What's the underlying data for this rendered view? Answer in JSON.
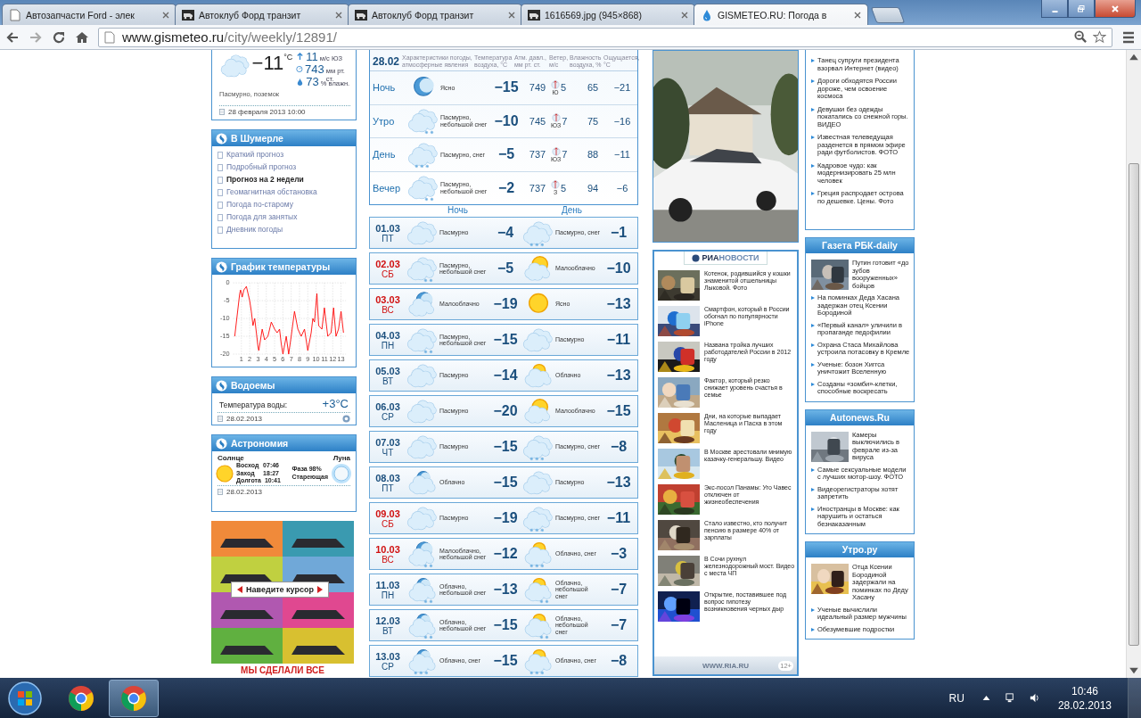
{
  "browser": {
    "tabs": [
      {
        "title": "Автозапчасти Ford - элек",
        "selected": false,
        "kind": "page"
      },
      {
        "title": "Автоклуб Форд транзит",
        "selected": false,
        "kind": "van"
      },
      {
        "title": "Автоклуб Форд транзит",
        "selected": false,
        "kind": "van"
      },
      {
        "title": "1616569.jpg (945×868)",
        "selected": false,
        "kind": "van"
      },
      {
        "title": "GISMETEO.RU: Погода в",
        "selected": true,
        "kind": "drop"
      }
    ],
    "address": {
      "host": "www.gismeteo.ru",
      "path": "/city/weekly/12891/"
    }
  },
  "current": {
    "temp": "−11",
    "unit": "°C",
    "wind_speed": "11",
    "wind_unit": "м/с ЮЗ",
    "pressure": "743",
    "pressure_unit": "мм рт. ст.",
    "humidity": "73",
    "humidity_unit": "% влажн.",
    "description": "Пасмурно, поземок",
    "timestamp": "28 февраля 2013 10:00"
  },
  "city_menu": {
    "title": "В Шумерле",
    "items": [
      {
        "label": "Краткий прогноз",
        "selected": false
      },
      {
        "label": "Подробный прогноз",
        "selected": false
      },
      {
        "label": "Прогноз на 2 недели",
        "selected": true
      },
      {
        "label": "Геомагнитная обстановка",
        "selected": false
      },
      {
        "label": "Погода по-старому",
        "selected": false
      },
      {
        "label": "Погода для занятых",
        "selected": false
      },
      {
        "label": "Дневник погоды",
        "selected": false
      }
    ]
  },
  "temperature_chart": {
    "title": "График температуры",
    "chart_data": {
      "type": "line",
      "grid": true,
      "x": [
        0.2,
        0.8,
        0.9,
        1.1,
        1.3,
        1.6,
        1.8,
        2.0,
        2.2,
        2.4,
        2.6,
        2.8,
        3.0,
        3.1,
        3.5,
        3.8,
        4.2,
        4.6,
        5.0,
        5.3,
        5.6,
        5.8,
        6.0,
        6.4,
        6.7,
        7.0,
        7.4,
        7.8,
        8.2,
        8.6,
        9.0,
        9.4,
        9.6,
        9.8,
        10.1,
        10.3,
        10.7,
        11.0,
        11.4,
        11.8,
        12.1,
        12.4,
        12.7,
        13.0,
        13.3
      ],
      "series": [
        {
          "color": "#ff0000",
          "values": [
            -15,
            -3,
            -2,
            -4,
            -2,
            -1,
            -3,
            -5,
            -8,
            -12,
            -10,
            -14,
            -18,
            -19,
            -13,
            -16,
            -15,
            -11,
            -13,
            -14,
            -13,
            -17,
            -20,
            -15,
            -20,
            -15,
            -8,
            -13,
            -15,
            -13,
            -19,
            -14,
            -10,
            -11,
            -3,
            -12,
            -13,
            -7,
            -15,
            -14,
            -7,
            -15,
            -13,
            -8,
            -14
          ]
        }
      ],
      "xlim": [
        0,
        13.6
      ],
      "ylim": [
        -20,
        0
      ],
      "xticks": [
        1,
        2,
        3,
        4,
        5,
        6,
        7,
        8,
        9,
        10,
        11,
        12,
        13
      ],
      "yticks": [
        0,
        -5,
        -10,
        -15,
        -20
      ]
    }
  },
  "water": {
    "title": "Водоемы",
    "label": "Температура воды:",
    "value": "+3°C",
    "date": "28.02.2013"
  },
  "astronomy": {
    "title": "Астрономия",
    "sun_label": "Солнце",
    "moon_label": "Луна",
    "sun_rows": [
      {
        "label": "Восход",
        "value": "07:46"
      },
      {
        "label": "Заход",
        "value": "18:27"
      },
      {
        "label": "Долгота",
        "value": "10:41"
      }
    ],
    "phase": "Фаза 98%",
    "phase_name": "Стареющая",
    "date": "28.02.2013"
  },
  "ad_banner": {
    "button": "Наведите курсор",
    "caption": "МЫ СДЕЛАЛИ ВСЕ"
  },
  "today": {
    "date": "28.02",
    "columns": [
      "Характеристики погоды, атмосферные явления",
      "Температура воздуха, °C",
      "Атм. давл., мм рт. ст.",
      "Ветер, м/с",
      "Влажность воздуха, %",
      "Ощущается, °C"
    ],
    "rows": [
      {
        "period": "Ночь",
        "icon": {
          "kind": "clear_night"
        },
        "description": "Ясно",
        "temp": "−15",
        "pressure": "749",
        "wind_speed": "5",
        "wind_direction": "Ю",
        "humidity": "65",
        "feels": "−21"
      },
      {
        "period": "Утро",
        "icon": {
          "kind": "overcast_light_snow"
        },
        "description": "Пасмурно, небольшой снег",
        "temp": "−10",
        "pressure": "745",
        "wind_speed": "7",
        "wind_direction": "ЮЗ",
        "humidity": "75",
        "feels": "−16"
      },
      {
        "period": "День",
        "icon": {
          "kind": "overcast_snow"
        },
        "description": "Пасмурно, снег",
        "temp": "−5",
        "pressure": "737",
        "wind_speed": "7",
        "wind_direction": "ЮЗ",
        "humidity": "88",
        "feels": "−11"
      },
      {
        "period": "Вечер",
        "icon": {
          "kind": "overcast_light_snow"
        },
        "description": "Пасмурно, небольшой снег",
        "temp": "−2",
        "pressure": "737",
        "wind_speed": "5",
        "wind_direction": "З",
        "humidity": "94",
        "feels": "−6"
      }
    ]
  },
  "forecast": {
    "night_label": "Ночь",
    "day_label": "День",
    "days": [
      {
        "date": "01.03",
        "weekday": "ПТ",
        "weekend": false,
        "night": {
          "kind": "overcast",
          "description": "Пасмурно",
          "temp": "−4"
        },
        "day": {
          "kind": "overcast_snow",
          "description": "Пасмурно, снег",
          "temp": "−1"
        }
      },
      {
        "date": "02.03",
        "weekday": "СБ",
        "weekend": true,
        "night": {
          "kind": "overcast_light_snow",
          "description": "Пасмурно, небольшой снег",
          "temp": "−5"
        },
        "day": {
          "kind": "partly",
          "description": "Малооблачно",
          "temp": "−10"
        }
      },
      {
        "date": "03.03",
        "weekday": "ВС",
        "weekend": true,
        "night": {
          "kind": "partly",
          "description": "Малооблачно",
          "temp": "−19"
        },
        "day": {
          "kind": "clear",
          "description": "Ясно",
          "temp": "−13"
        }
      },
      {
        "date": "04.03",
        "weekday": "ПН",
        "weekend": false,
        "night": {
          "kind": "overcast_light_snow",
          "description": "Пасмурно, небольшой снег",
          "temp": "−15"
        },
        "day": {
          "kind": "overcast",
          "description": "Пасмурно",
          "temp": "−11"
        }
      },
      {
        "date": "05.03",
        "weekday": "ВТ",
        "weekend": false,
        "night": {
          "kind": "overcast",
          "description": "Пасмурно",
          "temp": "−14"
        },
        "day": {
          "kind": "cloudy",
          "description": "Облачно",
          "temp": "−13"
        }
      },
      {
        "date": "06.03",
        "weekday": "СР",
        "weekend": false,
        "night": {
          "kind": "overcast",
          "description": "Пасмурно",
          "temp": "−20"
        },
        "day": {
          "kind": "partly",
          "description": "Малооблачно",
          "temp": "−15"
        }
      },
      {
        "date": "07.03",
        "weekday": "ЧТ",
        "weekend": false,
        "night": {
          "kind": "overcast",
          "description": "Пасмурно",
          "temp": "−15"
        },
        "day": {
          "kind": "overcast_snow",
          "description": "Пасмурно, снег",
          "temp": "−8"
        }
      },
      {
        "date": "08.03",
        "weekday": "ПТ",
        "weekend": false,
        "night": {
          "kind": "cloudy",
          "description": "Облачно",
          "temp": "−15"
        },
        "day": {
          "kind": "overcast",
          "description": "Пасмурно",
          "temp": "−13"
        }
      },
      {
        "date": "09.03",
        "weekday": "СБ",
        "weekend": true,
        "night": {
          "kind": "overcast",
          "description": "Пасмурно",
          "temp": "−19"
        },
        "day": {
          "kind": "overcast_snow",
          "description": "Пасмурно, снег",
          "temp": "−11"
        }
      },
      {
        "date": "10.03",
        "weekday": "ВС",
        "weekend": true,
        "night": {
          "kind": "partly_light_snow",
          "description": "Малооблачно, небольшой снег",
          "temp": "−12"
        },
        "day": {
          "kind": "cloudy_snow",
          "description": "Облачно, снег",
          "temp": "−3"
        }
      },
      {
        "date": "11.03",
        "weekday": "ПН",
        "weekend": false,
        "night": {
          "kind": "cloudy_light_snow",
          "description": "Облачно, небольшой снег",
          "temp": "−13"
        },
        "day": {
          "kind": "cloudy_light_snow",
          "description": "Облачно, небольшой снег",
          "temp": "−7"
        }
      },
      {
        "date": "12.03",
        "weekday": "ВТ",
        "weekend": false,
        "night": {
          "kind": "cloudy_light_snow",
          "description": "Облачно, небольшой снег",
          "temp": "−15"
        },
        "day": {
          "kind": "cloudy_light_snow",
          "description": "Облачно, небольшой снег",
          "temp": "−7"
        }
      },
      {
        "date": "13.03",
        "weekday": "СР",
        "weekend": false,
        "night": {
          "kind": "cloudy_snow",
          "description": "Облачно, снег",
          "temp": "−15"
        },
        "day": {
          "kind": "cloudy_snow",
          "description": "Облачно, снег",
          "temp": "−8"
        }
      }
    ]
  },
  "ria_news": {
    "logo_left": "РИА",
    "logo_right": "НОВОСТИ",
    "items": [
      "Котенок, родившийся у кошки знаменитой отшельницы Лыковой. Фото",
      "Смартфон, который в России обогнал по популярности iPhone",
      "Названа тройка лучших работодателей России в 2012 году",
      "Фактор, который резко снижает уровень счастья в семье",
      "Дни, на которые выпадает Масленица и Пасха в этом году",
      "В Москве арестовали мнимую казачку-генеральшу. Видео",
      "Экс-посол Панамы: Уго Чавес отключен от жизнеобеспечения",
      "Стало известно, кто получит пенсию в размере 40% от зарплаты",
      "В Сочи рухнул железнодорожный мост. Видео с места ЧП",
      "Открытие, поставившее под вопрос гипотезу возникновения черных дыр"
    ],
    "footer": "WWW.RIA.RU",
    "age": "12+"
  },
  "news_top": {
    "items": [
      "Танец супруги президента взорвал Интернет (видео)",
      "Дороги обходятся России дороже, чем освоение космоса",
      "Девушки без одежды покатались со снежной горы. ВИДЕО",
      "Известная телеведущая разденется в прямом эфире ради футболистов. ФОТО",
      "Кадровое чудо: как модернизировать 25 млн человек",
      "Греция распродает острова по дешевке. Цены. Фото"
    ]
  },
  "rbk_daily": {
    "title": "Газета РБК-daily",
    "featured": "Путин готовит «до зубов вооруженных» бойцов",
    "items": [
      "На поминках Деда Хасана задержан отец Ксении Бородиной",
      "«Первый канал» уличили в пропаганде педофилии",
      "Охрана Стаса Михайлова устроила потасовку в Кремле",
      "Ученые: бозон Хиггса уничтожит Вселенную",
      "Созданы «зомби»-клетки, способные воскресать"
    ]
  },
  "autonews": {
    "title": "Autonews.Ru",
    "featured": "Камеры выключились в феврале из-за вируса",
    "items": [
      "Самые сексуальные модели с лучших мотор-шоу. ФОТО",
      "Видеорегистраторы хотят запретить",
      "Иностранцы в Москве: как нарушить и остаться безнаказанным"
    ]
  },
  "utro": {
    "title": "Утро.ру",
    "featured": "Отца Ксении Бородиной задержали на поминках по Деду Хасану",
    "items": [
      "Ученые вычислили идеальный размер мужчины",
      "Обезумевшие подростки"
    ]
  },
  "taskbar": {
    "apps": [
      {
        "selected": false
      },
      {
        "selected": true
      }
    ],
    "language": "RU",
    "time": "10:46",
    "date": "28.02.2013"
  }
}
